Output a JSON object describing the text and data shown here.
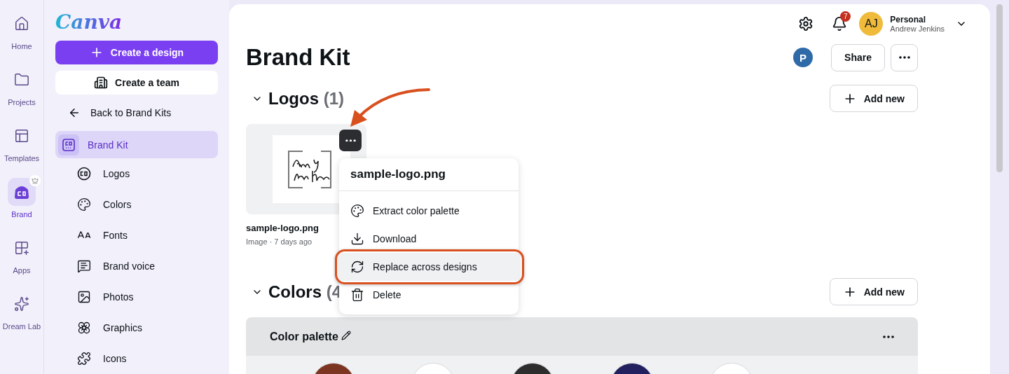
{
  "rail": {
    "items": [
      {
        "label": "Home",
        "selected": false,
        "premium": false
      },
      {
        "label": "Projects",
        "selected": false,
        "premium": false
      },
      {
        "label": "Templates",
        "selected": false,
        "premium": false
      },
      {
        "label": "Brand",
        "selected": true,
        "premium": true
      },
      {
        "label": "Apps",
        "selected": false,
        "premium": false
      },
      {
        "label": "Dream Lab",
        "selected": false,
        "premium": false
      }
    ]
  },
  "sidebar": {
    "logo": "Canva",
    "primary_button": "Create a design",
    "team_button": "Create a team",
    "back_link": "Back to Brand Kits",
    "items": [
      {
        "label": "Brand Kit",
        "selected": true
      },
      {
        "label": "Logos",
        "selected": false
      },
      {
        "label": "Colors",
        "selected": false
      },
      {
        "label": "Fonts",
        "selected": false
      },
      {
        "label": "Brand voice",
        "selected": false
      },
      {
        "label": "Photos",
        "selected": false
      },
      {
        "label": "Graphics",
        "selected": false
      },
      {
        "label": "Icons",
        "selected": false
      }
    ]
  },
  "header": {
    "notifications_count": "7",
    "account": {
      "initials": "AJ",
      "plan": "Personal",
      "name": "Andrew Jenkins"
    }
  },
  "page": {
    "title": "Brand Kit",
    "avatar": "P",
    "share_button": "Share"
  },
  "logos": {
    "title": "Logos",
    "count": "(1)",
    "expanded": true,
    "add_button": "Add new",
    "items": [
      {
        "filename": "sample-logo.png",
        "meta": "Image · 7 days ago"
      }
    ]
  },
  "colors": {
    "title": "Colors",
    "count": "(4",
    "expanded": true,
    "add_button": "Add new",
    "palette": {
      "name": "Color palette",
      "swatches": [
        {
          "color": "#7b3520"
        },
        {
          "color": "#ffffff"
        },
        {
          "color": "#2d2d2d"
        },
        {
          "color": "#22205e"
        },
        {
          "color": "#ffffff"
        }
      ]
    }
  },
  "context_menu": {
    "title": "sample-logo.png",
    "items": [
      {
        "label": "Extract color palette",
        "highlighted": false
      },
      {
        "label": "Download",
        "highlighted": false
      },
      {
        "label": "Replace across designs",
        "highlighted": true
      },
      {
        "label": "Delete",
        "highlighted": false
      }
    ]
  }
}
